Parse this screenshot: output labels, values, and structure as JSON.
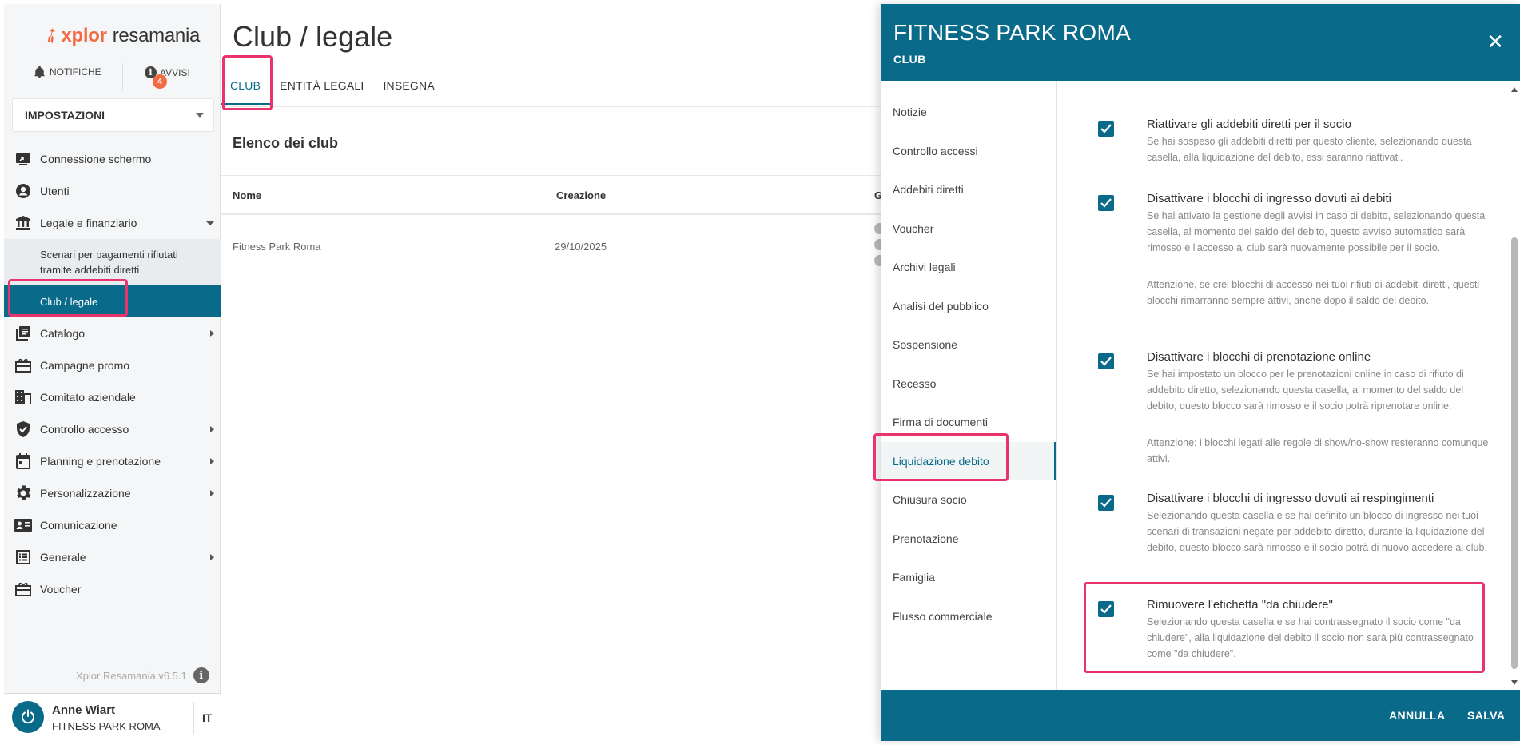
{
  "app": {
    "logo_brand": "xplor",
    "logo_product": "resamania",
    "notifications_label": "NOTIFICHE",
    "alerts_label": "AVVISI",
    "alerts_count": "4",
    "settings_select": "IMPOSTAZIONI",
    "version": "Xplor Resamania v6.5.1",
    "user_name": "Anne Wiart",
    "user_club": "FITNESS PARK ROMA",
    "language": "IT",
    "accent_color": "#0a6a8a",
    "highlight_color": "#e8336b"
  },
  "sidebar": {
    "items": [
      {
        "label": "Connessione schermo",
        "icon": "screen-share-icon"
      },
      {
        "label": "Utenti",
        "icon": "user-icon"
      },
      {
        "label": "Legale e finanziario",
        "icon": "bank-icon"
      },
      {
        "label": "Catalogo",
        "icon": "catalog-icon"
      },
      {
        "label": "Campagne promo",
        "icon": "gift-icon"
      },
      {
        "label": "Comitato aziendale",
        "icon": "building-icon"
      },
      {
        "label": "Controllo accesso",
        "icon": "shield-icon"
      },
      {
        "label": "Planning e prenotazione",
        "icon": "calendar-icon"
      },
      {
        "label": "Personalizzazione",
        "icon": "gear-icon"
      },
      {
        "label": "Comunicazione",
        "icon": "contact-card-icon"
      },
      {
        "label": "Generale",
        "icon": "list-icon"
      },
      {
        "label": "Voucher",
        "icon": "voucher-icon"
      }
    ],
    "sub_items": [
      {
        "label": "Scenari per pagamenti rifiutati tramite addebiti diretti"
      },
      {
        "label": "Club / legale"
      }
    ]
  },
  "main": {
    "title": "Club / legale",
    "tabs": [
      {
        "label": "CLUB"
      },
      {
        "label": "ENTITÀ LEGALI"
      },
      {
        "label": "INSEGNA"
      }
    ],
    "section_title": "Elenco dei club",
    "columns": [
      "Nome",
      "Creazione",
      "G"
    ],
    "rows": [
      {
        "name": "Fitness Park Roma",
        "created": "29/10/2025"
      }
    ]
  },
  "panel": {
    "title": "FITNESS PARK ROMA",
    "subtitle": "CLUB",
    "nav": [
      {
        "label": "Notizie"
      },
      {
        "label": "Controllo accessi"
      },
      {
        "label": "Addebiti diretti"
      },
      {
        "label": "Voucher"
      },
      {
        "label": "Archivi legali"
      },
      {
        "label": "Analisi del pubblico"
      },
      {
        "label": "Sospensione"
      },
      {
        "label": "Recesso"
      },
      {
        "label": "Firma di documenti"
      },
      {
        "label": "Liquidazione debito"
      },
      {
        "label": "Chiusura socio"
      },
      {
        "label": "Prenotazione"
      },
      {
        "label": "Famiglia"
      },
      {
        "label": "Flusso commerciale"
      }
    ],
    "options": [
      {
        "title": "Riattivare gli addebiti diretti per il socio",
        "desc": "Se hai sospeso gli addebiti diretti per questo cliente, selezionando questa casella, alla liquidazione del debito, essi saranno riattivati.",
        "note": "",
        "checked": true
      },
      {
        "title": "Disattivare i blocchi di ingresso dovuti ai debiti",
        "desc": "Se hai attivato la gestione degli avvisi in caso di debito, selezionando questa casella, al momento del saldo del debito, questo avviso automatico sarà rimosso e l'accesso al club sarà nuovamente possibile per il socio.",
        "note": "Attenzione, se crei blocchi di accesso nei tuoi rifiuti di addebiti diretti, questi blocchi rimarranno sempre attivi, anche dopo il saldo del debito.",
        "checked": true
      },
      {
        "title": "Disattivare i blocchi di prenotazione online",
        "desc": "Se hai impostato un blocco per le prenotazioni online in caso di rifiuto di addebito diretto, selezionando questa casella, al momento del saldo del debito, questo blocco sarà rimosso e il socio potrà riprenotare online.",
        "note": "Attenzione: i blocchi legati alle regole di show/no-show resteranno comunque attivi.",
        "checked": true
      },
      {
        "title": "Disattivare i blocchi di ingresso dovuti ai respingimenti",
        "desc": "Selezionando questa casella e se hai definito un blocco di ingresso nei tuoi scenari di transazioni negate per addebito diretto, durante la liquidazione del debito, questo blocco sarà rimosso e il socio potrà di nuovo accedere al club.",
        "note": "",
        "checked": true
      },
      {
        "title": "Rimuovere l'etichetta \"da chiudere\"",
        "desc": "Selezionando questa casella e se hai contrassegnato il socio come \"da chiudere\", alla liquidazione del debito il socio non sarà più contrassegnato come \"da chiudere\".",
        "note": "",
        "checked": true
      }
    ],
    "cancel_label": "ANNULLA",
    "save_label": "SALVA"
  }
}
